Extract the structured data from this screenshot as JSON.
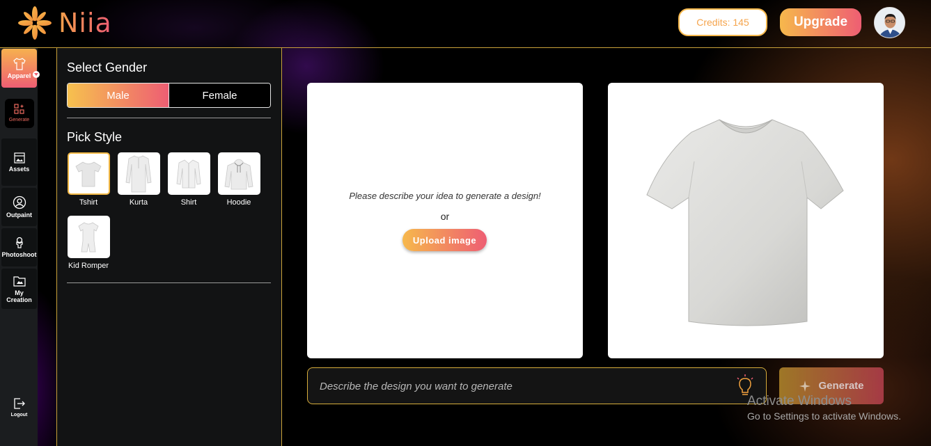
{
  "header": {
    "brand": "Niia",
    "credits_label": "Credits: 145",
    "upgrade_label": "Upgrade"
  },
  "rail": {
    "apparel": "Apparel",
    "generate": "Generate",
    "assets": "Assets",
    "outpaint": "Outpaint",
    "photoshoot": "Photoshoot",
    "my_creation": "My Creation",
    "logout": "Logout"
  },
  "panel": {
    "gender_title": "Select Gender",
    "gender_options": [
      "Male",
      "Female"
    ],
    "selected_gender": "Male",
    "style_title": "Pick Style",
    "styles": [
      "Tshirt",
      "Kurta",
      "Shirt",
      "Hoodie",
      "Kid Romper"
    ],
    "selected_style": "Tshirt"
  },
  "main": {
    "prompt_text": "Please describe your idea to generate a design!",
    "or_text": "or",
    "upload_label": "Upload image",
    "describe_placeholder": "Describe the design you want to generate",
    "generate_label": "Generate"
  },
  "watermark": {
    "line1": "Activate Windows",
    "line2": "Go to Settings to activate Windows."
  },
  "colors": {
    "accent_start": "#f6b84c",
    "accent_end": "#ee5e73",
    "border_gold": "#c9a23a"
  }
}
